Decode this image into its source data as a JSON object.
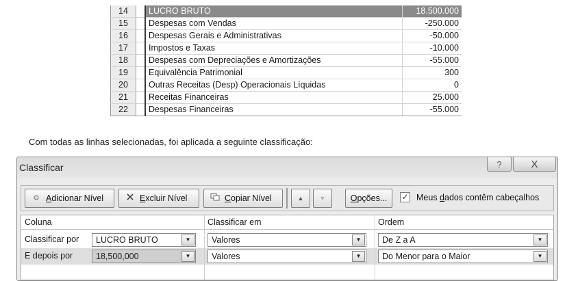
{
  "sheet": {
    "rows": [
      {
        "num": "14",
        "label": "LUCRO BRUTO",
        "value": "18.500.000"
      },
      {
        "num": "15",
        "label": "Despesas com Vendas",
        "value": "-250.000"
      },
      {
        "num": "16",
        "label": "Despesas Gerais e Administrativas",
        "value": "-50.000"
      },
      {
        "num": "17",
        "label": "Impostos e Taxas",
        "value": "-10.000"
      },
      {
        "num": "18",
        "label": "Despesas com Depreciações e Amortizações",
        "value": "-55.000"
      },
      {
        "num": "19",
        "label": "Equivalência Patrimonial",
        "value": "300"
      },
      {
        "num": "20",
        "label": "Outras Receitas (Desp) Operacionais Líquidas",
        "value": "0"
      },
      {
        "num": "21",
        "label": "Receitas Financeiras",
        "value": "25.000"
      },
      {
        "num": "22",
        "label": "Despesas Financeiras",
        "value": "-55.000"
      }
    ]
  },
  "caption": "Com todas as linhas selecionadas, foi aplicada a seguinte classificação:",
  "dialog": {
    "title": "Classificar",
    "help_glyph": "?",
    "close_glyph": "X",
    "toolbar": {
      "add_u": "A",
      "add_rest": "dicionar Nível",
      "delete_u": "E",
      "delete_rest": "xcluir Nível",
      "copy_u": "C",
      "copy_rest": "opiar Nível",
      "up_glyph": "▲",
      "down_glyph": "▼",
      "options_u": "O",
      "options_rest": "pções...",
      "header_check_glyph": "✓",
      "header_pre": "Meus ",
      "header_u": "d",
      "header_post": "ados contêm cabeçalhos",
      "header_checked": true
    },
    "columns": {
      "col1": "Coluna",
      "col2": "Classificar em",
      "col3": "Ordem"
    },
    "levels": [
      {
        "label": "Classificar por",
        "column": "LUCRO BRUTO",
        "sort_on": "Valores",
        "order": "De Z a A"
      },
      {
        "label": "E depois por",
        "column": "18,500,000",
        "sort_on": "Valores",
        "order": "Do Menor para o Maior"
      }
    ],
    "dropdown_glyph": "▼"
  }
}
